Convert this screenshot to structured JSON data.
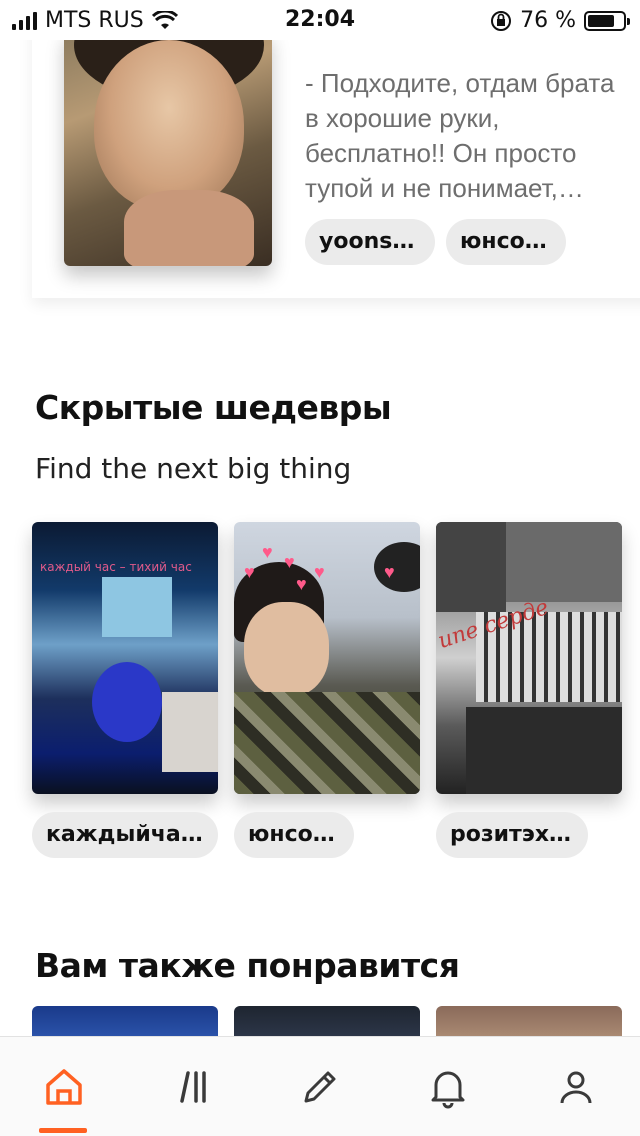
{
  "status_bar": {
    "carrier": "MTS RUS",
    "time": "22:04",
    "battery_percent": "76 %",
    "battery_level": 0.76
  },
  "story": {
    "excerpt": "- Подходите, отдам брата в хорошие руки, бесплатно!! Он просто тупой и не понимает,…",
    "tags": [
      "yoonseok",
      "юнсоки"
    ]
  },
  "hidden_gems": {
    "title": "Скрытые шедевры",
    "subtitle": "Find the next big thing",
    "books": [
      {
        "tag": "каждыйча..."
      },
      {
        "tag": "юнсоки"
      },
      {
        "tag": "розитэхен"
      }
    ]
  },
  "also_like": {
    "title": "Вам также понравится"
  },
  "bottom_nav": {
    "items": [
      {
        "icon": "home-icon",
        "active": true
      },
      {
        "icon": "library-icon",
        "active": false
      },
      {
        "icon": "pencil-icon",
        "active": false
      },
      {
        "icon": "bell-icon",
        "active": false
      },
      {
        "icon": "profile-icon",
        "active": false
      }
    ],
    "active_color": "#ff6122",
    "icon_color": "#3a3a3a"
  },
  "colors": {
    "accent": "#ff6122",
    "tag_background": "#ebebeb",
    "excerpt_text": "#6e6e6e"
  }
}
